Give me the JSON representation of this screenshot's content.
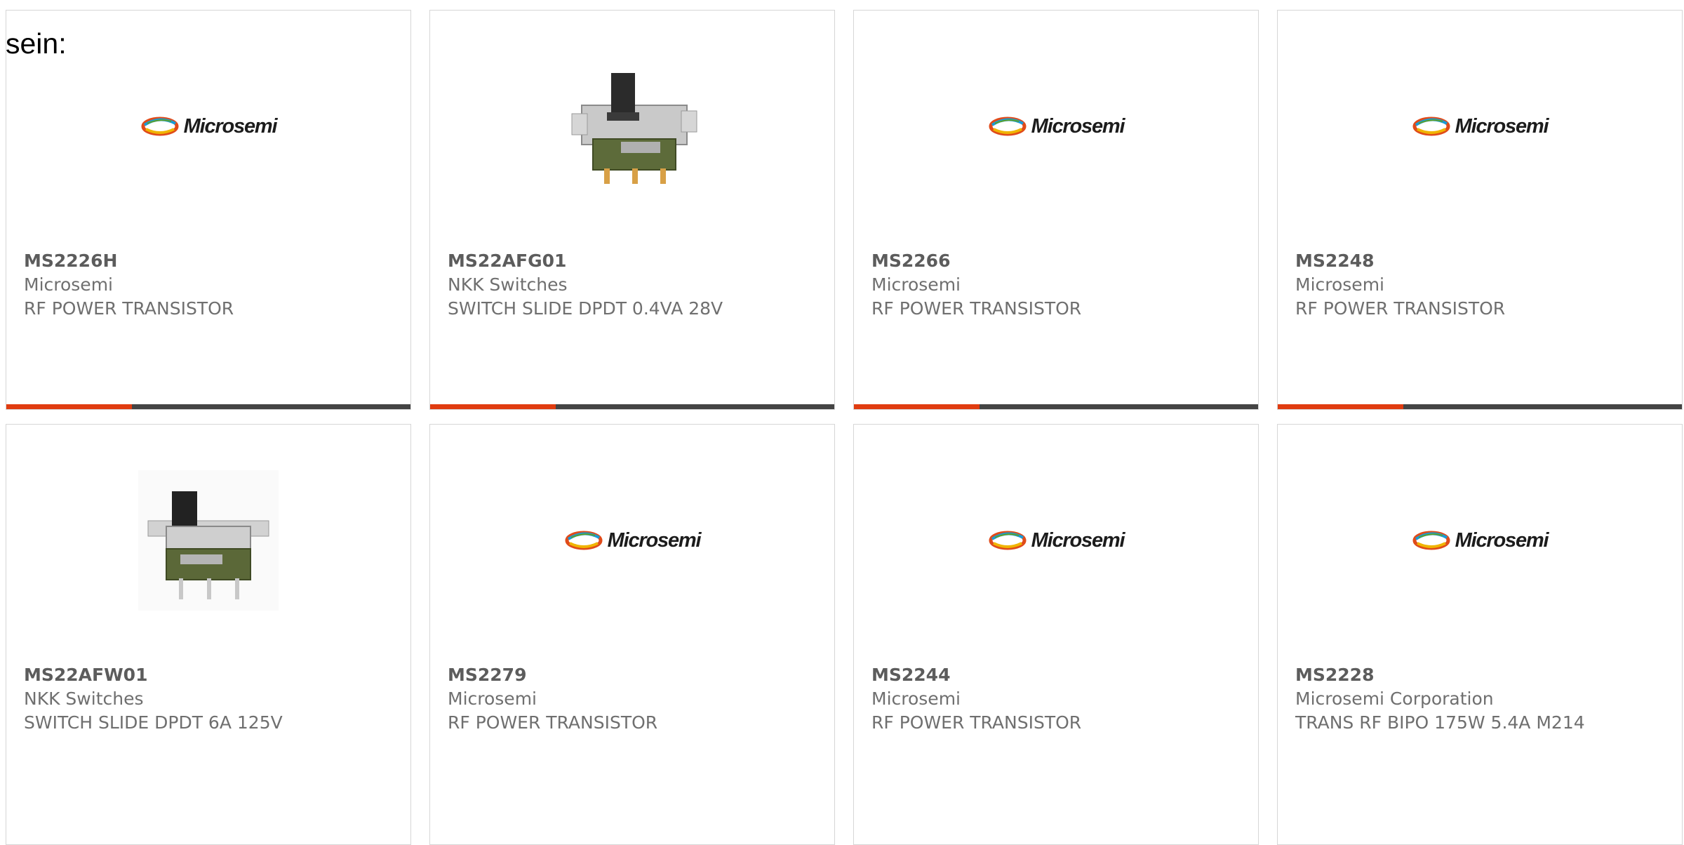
{
  "intro_text": "sein:",
  "colors": {
    "accent": "#e03c10",
    "bar": "#444444",
    "border": "#d6d6d6",
    "text": "#6f6f6f"
  },
  "products": [
    {
      "part_number": "MS2226H",
      "manufacturer": "Microsemi",
      "description": "RF POWER TRANSISTOR",
      "image": "microsemi-logo",
      "logo_text": "Microsemi",
      "progress": 0.31
    },
    {
      "part_number": "MS22AFG01",
      "manufacturer": "NKK Switches",
      "description": "SWITCH SLIDE DPDT 0.4VA 28V",
      "image": "slide-switch-photo",
      "progress": 0.31
    },
    {
      "part_number": "MS2266",
      "manufacturer": "Microsemi",
      "description": "RF POWER TRANSISTOR",
      "image": "microsemi-logo",
      "logo_text": "Microsemi",
      "progress": 0.31
    },
    {
      "part_number": "MS2248",
      "manufacturer": "Microsemi",
      "description": "RF POWER TRANSISTOR",
      "image": "microsemi-logo",
      "logo_text": "Microsemi",
      "progress": 0.31
    },
    {
      "part_number": "MS22AFW01",
      "manufacturer": "NKK Switches",
      "description": "SWITCH SLIDE DPDT 6A 125V",
      "image": "slide-switch-photo"
    },
    {
      "part_number": "MS2279",
      "manufacturer": "Microsemi",
      "description": "RF POWER TRANSISTOR",
      "image": "microsemi-logo",
      "logo_text": "Microsemi"
    },
    {
      "part_number": "MS2244",
      "manufacturer": "Microsemi",
      "description": "RF POWER TRANSISTOR",
      "image": "microsemi-logo",
      "logo_text": "Microsemi"
    },
    {
      "part_number": "MS2228",
      "manufacturer": "Microsemi Corporation",
      "description": "TRANS RF BIPO 175W 5.4A M214",
      "image": "microsemi-logo",
      "logo_text": "Microsemi"
    }
  ]
}
